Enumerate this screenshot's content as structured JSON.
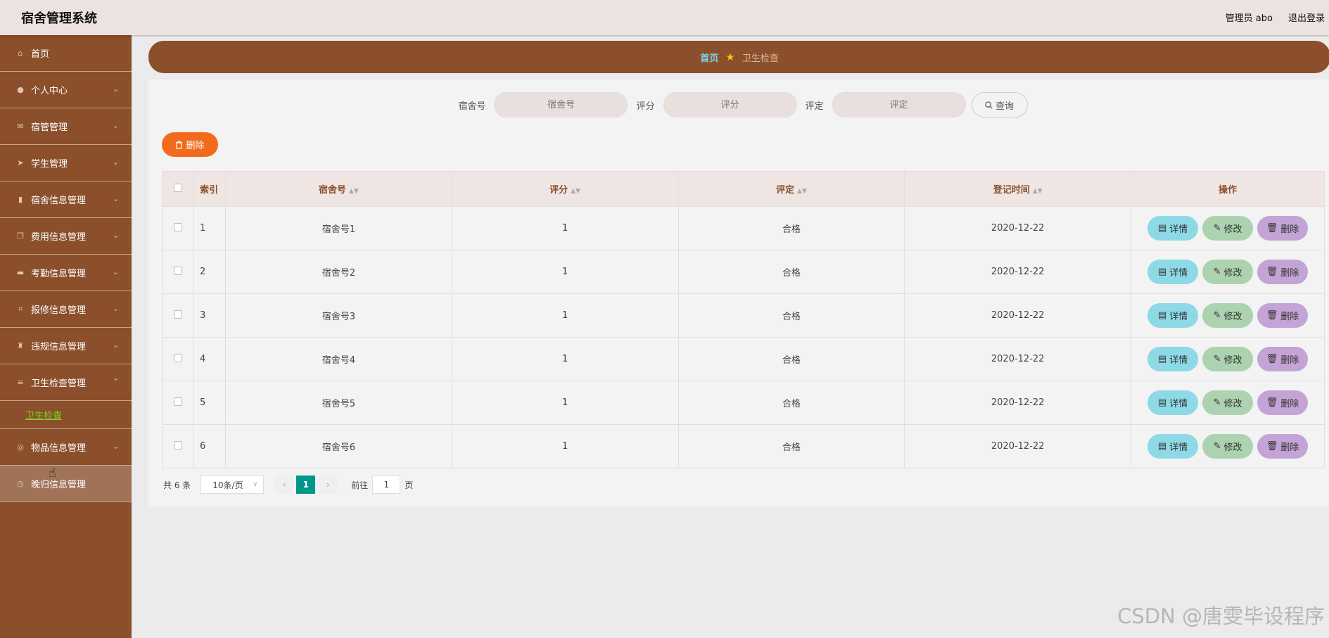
{
  "app": {
    "title": "宿舍管理系统",
    "user": "管理员 abo",
    "logout": "退出登录"
  },
  "sidebar": {
    "items": [
      {
        "label": "首页",
        "icon": "home-icon",
        "has_chevron": false
      },
      {
        "label": "个人中心",
        "icon": "user-icon",
        "has_chevron": true
      },
      {
        "label": "宿管管理",
        "icon": "mail-icon",
        "has_chevron": true
      },
      {
        "label": "学生管理",
        "icon": "send-icon",
        "has_chevron": true
      },
      {
        "label": "宿舍信息管理",
        "icon": "chart-icon",
        "has_chevron": true
      },
      {
        "label": "费用信息管理",
        "icon": "copy-icon",
        "has_chevron": true
      },
      {
        "label": "考勤信息管理",
        "icon": "monitor-icon",
        "has_chevron": true
      },
      {
        "label": "报修信息管理",
        "icon": "crop-icon",
        "has_chevron": true
      },
      {
        "label": "违规信息管理",
        "icon": "trophy-icon",
        "has_chevron": true
      },
      {
        "label": "卫生检查管理",
        "icon": "list-icon",
        "has_chevron": true,
        "expanded": true
      }
    ],
    "sub_item": "卫生检查",
    "items_after": [
      {
        "label": "物品信息管理",
        "icon": "compass-icon",
        "has_chevron": true
      },
      {
        "label": "晚归信息管理",
        "icon": "clock-icon",
        "has_chevron": false
      }
    ]
  },
  "breadcrumb": {
    "home": "首页",
    "current": "卫生检查"
  },
  "search": {
    "fields": [
      {
        "label": "宿舍号",
        "placeholder": "宿舍号"
      },
      {
        "label": "评分",
        "placeholder": "评分"
      },
      {
        "label": "评定",
        "placeholder": "评定"
      }
    ],
    "query_label": "查询"
  },
  "toolbar": {
    "delete_label": "删除"
  },
  "table": {
    "headers": {
      "index": "索引",
      "room": "宿舍号",
      "score": "评分",
      "rating": "评定",
      "date": "登记时间",
      "actions": "操作"
    },
    "rows": [
      {
        "index": "1",
        "room": "宿舍号1",
        "score": "1",
        "rating": "合格",
        "date": "2020-12-22"
      },
      {
        "index": "2",
        "room": "宿舍号2",
        "score": "1",
        "rating": "合格",
        "date": "2020-12-22"
      },
      {
        "index": "3",
        "room": "宿舍号3",
        "score": "1",
        "rating": "合格",
        "date": "2020-12-22"
      },
      {
        "index": "4",
        "room": "宿舍号4",
        "score": "1",
        "rating": "合格",
        "date": "2020-12-22"
      },
      {
        "index": "5",
        "room": "宿舍号5",
        "score": "1",
        "rating": "合格",
        "date": "2020-12-22"
      },
      {
        "index": "6",
        "room": "宿舍号6",
        "score": "1",
        "rating": "合格",
        "date": "2020-12-22"
      }
    ],
    "action_labels": {
      "detail": "详情",
      "edit": "修改",
      "delete": "删除"
    }
  },
  "pagination": {
    "total": "共 6 条",
    "page_size": "10条/页",
    "current_page": "1",
    "goto_label": "前往",
    "goto_value": "1",
    "page_suffix": "页"
  },
  "watermark": "CSDN @唐雯毕设程序",
  "colors": {
    "sidebar": "#8b4f2b",
    "accent_orange": "#f26b1d",
    "page_active": "#009688",
    "detail": "#8dd9e6",
    "edit": "#acd2b0",
    "delete": "#c4a3d6"
  }
}
